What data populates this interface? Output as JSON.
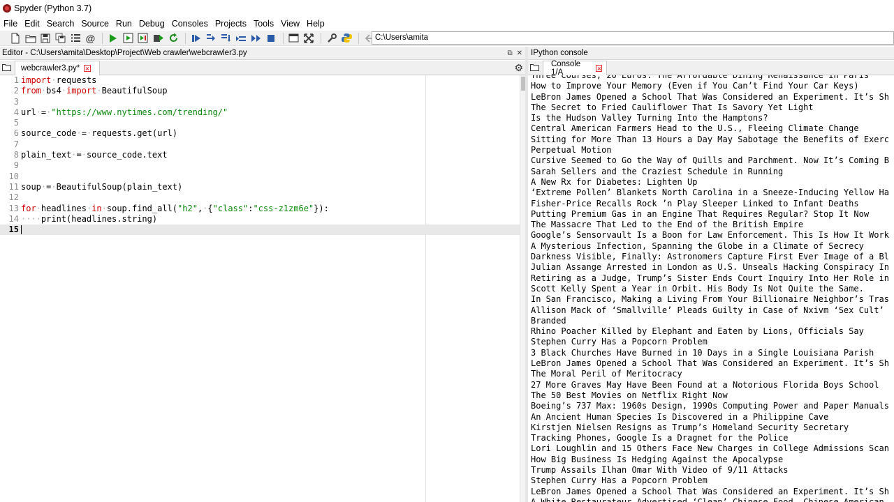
{
  "window": {
    "title": "Spyder (Python 3.7)"
  },
  "menu": [
    "File",
    "Edit",
    "Search",
    "Source",
    "Run",
    "Debug",
    "Consoles",
    "Projects",
    "Tools",
    "View",
    "Help"
  ],
  "toolbar": {
    "path": "C:\\Users\\amita"
  },
  "editor": {
    "header": "Editor - C:\\Users\\amita\\Desktop\\Project\\Web crawler\\webcrawler3.py",
    "tab_label": "webcrawler3.py*",
    "current_line": 15,
    "lines": [
      {
        "n": "1",
        "tokens": [
          {
            "t": "import",
            "c": "kw"
          },
          {
            "t": "·",
            "c": "ws"
          },
          {
            "t": "requests",
            "c": ""
          }
        ]
      },
      {
        "n": "2",
        "tokens": [
          {
            "t": "from",
            "c": "kw"
          },
          {
            "t": "·",
            "c": "ws"
          },
          {
            "t": "bs4",
            "c": ""
          },
          {
            "t": "·",
            "c": "ws"
          },
          {
            "t": "import",
            "c": "kw"
          },
          {
            "t": "·",
            "c": "ws"
          },
          {
            "t": "BeautifulSoup",
            "c": ""
          }
        ]
      },
      {
        "n": "3",
        "tokens": []
      },
      {
        "n": "4",
        "tokens": [
          {
            "t": "url",
            "c": ""
          },
          {
            "t": "·",
            "c": "ws"
          },
          {
            "t": "=",
            "c": ""
          },
          {
            "t": "·",
            "c": "ws"
          },
          {
            "t": "\"https://www.nytimes.com/trending/\"",
            "c": "str"
          }
        ]
      },
      {
        "n": "5",
        "tokens": []
      },
      {
        "n": "6",
        "tokens": [
          {
            "t": "source_code",
            "c": ""
          },
          {
            "t": "·",
            "c": "ws"
          },
          {
            "t": "=",
            "c": ""
          },
          {
            "t": "·",
            "c": "ws"
          },
          {
            "t": "requests.get(url)",
            "c": ""
          }
        ]
      },
      {
        "n": "7",
        "tokens": []
      },
      {
        "n": "8",
        "tokens": [
          {
            "t": "plain_text",
            "c": ""
          },
          {
            "t": "·",
            "c": "ws"
          },
          {
            "t": "=",
            "c": ""
          },
          {
            "t": "·",
            "c": "ws"
          },
          {
            "t": "source_code.text",
            "c": ""
          }
        ]
      },
      {
        "n": "9",
        "tokens": []
      },
      {
        "n": "10",
        "tokens": []
      },
      {
        "n": "11",
        "tokens": [
          {
            "t": "soup",
            "c": ""
          },
          {
            "t": "·",
            "c": "ws"
          },
          {
            "t": "=",
            "c": ""
          },
          {
            "t": "·",
            "c": "ws"
          },
          {
            "t": "BeautifulSoup(plain_text)",
            "c": ""
          }
        ]
      },
      {
        "n": "12",
        "tokens": []
      },
      {
        "n": "13",
        "tokens": [
          {
            "t": "for",
            "c": "kw"
          },
          {
            "t": "·",
            "c": "ws"
          },
          {
            "t": "headlines",
            "c": ""
          },
          {
            "t": "·",
            "c": "ws"
          },
          {
            "t": "in",
            "c": "kw"
          },
          {
            "t": "·",
            "c": "ws"
          },
          {
            "t": "soup.find_all(",
            "c": ""
          },
          {
            "t": "\"h2\"",
            "c": "str"
          },
          {
            "t": ",",
            "c": ""
          },
          {
            "t": "·",
            "c": "ws"
          },
          {
            "t": "{",
            "c": ""
          },
          {
            "t": "\"class\"",
            "c": "str"
          },
          {
            "t": ":",
            "c": ""
          },
          {
            "t": "\"css-z1zm6e\"",
            "c": "str"
          },
          {
            "t": "}):",
            "c": ""
          }
        ]
      },
      {
        "n": "14",
        "tokens": [
          {
            "t": "····",
            "c": "ws"
          },
          {
            "t": "print(headlines.string)",
            "c": ""
          }
        ]
      },
      {
        "n": "15",
        "tokens": []
      }
    ]
  },
  "console": {
    "header": "IPython console",
    "tab_label": "Console 1/A",
    "output": [
      "Three Courses, 20 Euros: The Affordable Dining Renaissance in Paris",
      "How to Improve Your Memory (Even if You Can’t Find Your Car Keys)",
      "LeBron James Opened a School That Was Considered an Experiment. It’s Sh",
      "The Secret to Fried Cauliflower That Is Savory Yet Light",
      "Is the Hudson Valley Turning Into the Hamptons?",
      "Central American Farmers Head to the U.S., Fleeing Climate Change",
      "Sitting for More Than 13 Hours a Day May Sabotage the Benefits of Exerc",
      "Perpetual Motion",
      "Cursive Seemed to Go the Way of Quills and Parchment. Now It’s Coming B",
      "Sarah Sellers and the Craziest Schedule in Running",
      "A New Rx for Diabetes: Lighten Up",
      "‘Extreme Pollen’ Blankets North Carolina in a Sneeze-Inducing Yellow Ha",
      "Fisher-Price Recalls Rock ’n Play Sleeper Linked to Infant Deaths",
      "Putting Premium Gas in an Engine That Requires Regular? Stop It Now",
      "The Massacre That Led to the End of the British Empire",
      "Google’s Sensorvault Is a Boon for Law Enforcement. This Is How It Work",
      "A Mysterious Infection, Spanning the Globe in a Climate of Secrecy",
      "Darkness Visible, Finally: Astronomers Capture First Ever Image of a Bl",
      "Julian Assange Arrested in London as U.S. Unseals Hacking Conspiracy In",
      "Retiring as a Judge, Trump’s Sister Ends Court Inquiry Into Her Role in",
      "Scott Kelly Spent a Year in Orbit. His Body Is Not Quite the Same.",
      "In San Francisco, Making a Living From Your Billionaire Neighbor’s Tras",
      "Allison Mack of ‘Smallville’ Pleads Guilty in Case of Nxivm ‘Sex Cult’",
      "Branded",
      "Rhino Poacher Killed by Elephant and Eaten by Lions, Officials Say",
      "Stephen Curry Has a Popcorn Problem",
      "3 Black Churches Have Burned in 10 Days in a Single Louisiana Parish",
      "LeBron James Opened a School That Was Considered an Experiment. It’s Sh",
      "The Moral Peril of Meritocracy",
      "27 More Graves May Have Been Found at a Notorious Florida Boys School",
      "The 50 Best Movies on Netflix Right Now",
      "Boeing’s 737 Max: 1960s Design, 1990s Computing Power and Paper Manuals",
      "An Ancient Human Species Is Discovered in a Philippine Cave",
      "Kirstjen Nielsen Resigns as Trump’s Homeland Security Secretary",
      "Tracking Phones, Google Is a Dragnet for the Police",
      "Lori Loughlin and 15 Others Face New Charges in College Admissions Scan",
      "How Big Business Is Hedging Against the Apocalypse",
      "Trump Assails Ilhan Omar With Video of 9/11 Attacks",
      "Stephen Curry Has a Popcorn Problem",
      "LeBron James Opened a School That Was Considered an Experiment. It’s Sh",
      "A White Restaurateur Advertised ‘Clean’ Chinese Food. Chinese-American"
    ]
  }
}
